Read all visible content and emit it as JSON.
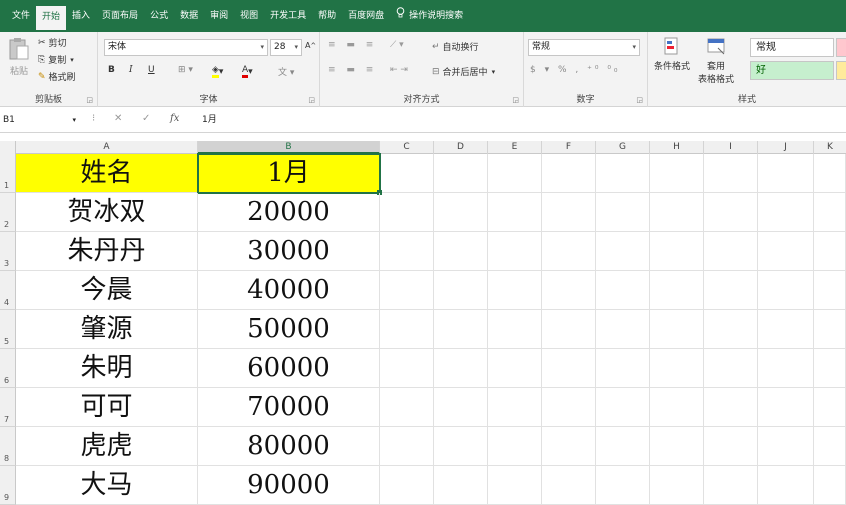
{
  "menu": {
    "tabs": [
      "文件",
      "开始",
      "插入",
      "页面布局",
      "公式",
      "数据",
      "审阅",
      "视图",
      "开发工具",
      "帮助",
      "百度网盘"
    ],
    "active_tab": "开始",
    "tell_me": "操作说明搜索"
  },
  "ribbon": {
    "clipboard": {
      "label": "剪贴板",
      "paste": "粘贴",
      "cut": "剪切",
      "copy": "复制",
      "format_painter": "格式刷"
    },
    "font": {
      "label": "字体",
      "font_name": "宋体",
      "font_size": "28"
    },
    "alignment": {
      "label": "对齐方式",
      "wrap_text": "自动换行",
      "merge_center": "合并后居中"
    },
    "number": {
      "label": "数字",
      "format": "常规"
    },
    "styles": {
      "label": "样式",
      "conditional_format": "条件格式",
      "format_table_line1": "套用",
      "format_table_line2": "表格格式",
      "normal": "常规",
      "good": "好"
    }
  },
  "formula_bar": {
    "name_box": "B1",
    "fx": "fx",
    "content": "1月"
  },
  "sheet": {
    "columns": [
      "A",
      "B",
      "C",
      "D",
      "E",
      "F",
      "G",
      "H",
      "I",
      "J",
      "K"
    ],
    "selected_column": "B",
    "rows": [
      {
        "num": "1",
        "a": "姓名",
        "b": "1月"
      },
      {
        "num": "2",
        "a": "贺冰双",
        "b": "20000"
      },
      {
        "num": "3",
        "a": "朱丹丹",
        "b": "30000"
      },
      {
        "num": "4",
        "a": "今晨",
        "b": "40000"
      },
      {
        "num": "5",
        "a": "肇源",
        "b": "50000"
      },
      {
        "num": "6",
        "a": "朱明",
        "b": "60000"
      },
      {
        "num": "7",
        "a": "可可",
        "b": "70000"
      },
      {
        "num": "8",
        "a": "虎虎",
        "b": "80000"
      },
      {
        "num": "9",
        "a": "大马",
        "b": "90000"
      }
    ],
    "colors": {
      "header_fill": "#ffff00",
      "accent": "#217346"
    }
  }
}
